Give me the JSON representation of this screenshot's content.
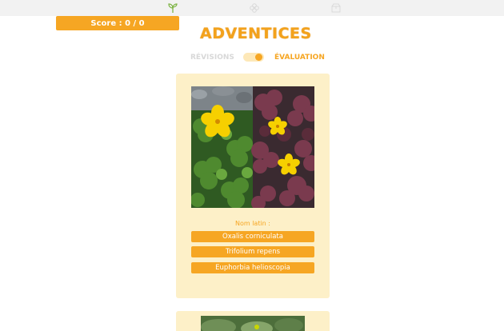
{
  "nav": {
    "items": [
      {
        "icon": "sprout-icon",
        "active": true
      },
      {
        "icon": "flower-icon",
        "active": false
      },
      {
        "icon": "box-icon",
        "active": false
      }
    ]
  },
  "score": {
    "label": "Score : 0 / 0"
  },
  "app": {
    "title": "ADVENTICES"
  },
  "mode": {
    "left_label": "RÉVISIONS",
    "right_label": "ÉVALUATION",
    "toggle_on": true
  },
  "quiz": {
    "question_label": "Nom latin :",
    "answers": [
      "Oxalis corniculata",
      "Trifolium repens",
      "Euphorbia helioscopia"
    ]
  },
  "colors": {
    "accent": "#f6a623",
    "card_bg": "#fdf0c8",
    "nav_bg": "#f2f2f2",
    "inactive_text": "#d8d8d8"
  }
}
